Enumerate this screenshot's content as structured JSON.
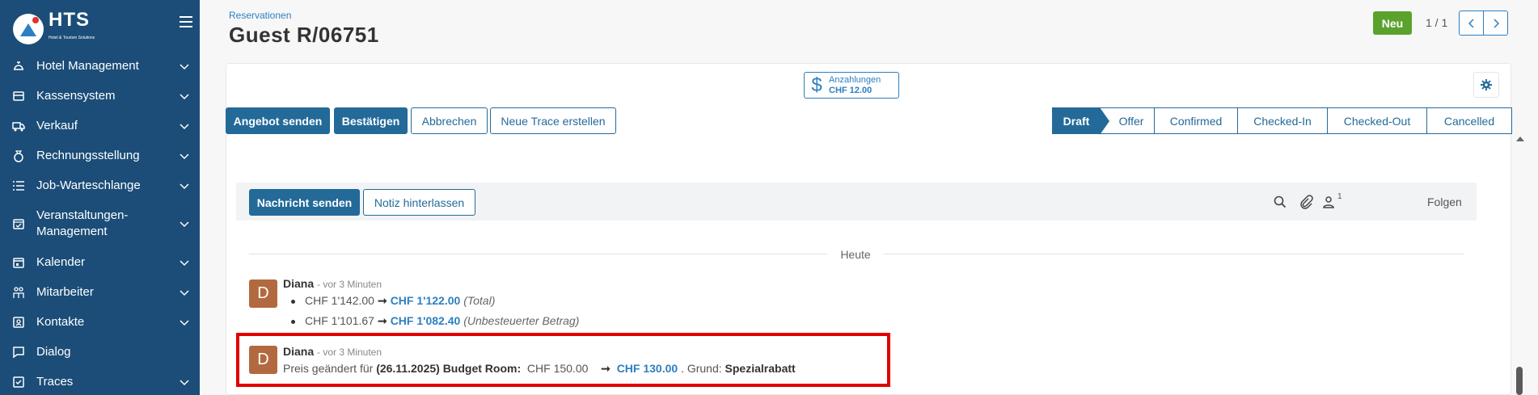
{
  "sidebar": {
    "brand": "HTS",
    "brand_sub": "Hotel & Tourism Solutions",
    "items": [
      {
        "label": "Hotel Management",
        "icon": "bell-icon"
      },
      {
        "label": "Kassensystem",
        "icon": "register-icon"
      },
      {
        "label": "Verkauf",
        "icon": "truck-icon"
      },
      {
        "label": "Rechnungsstellung",
        "icon": "money-bag-icon"
      },
      {
        "label": "Job-Warteschlange",
        "icon": "list-icon"
      },
      {
        "label": "Veranstaltungen-Management",
        "icon": "calendar-check-icon"
      },
      {
        "label": "Kalender",
        "icon": "calendar-icon"
      },
      {
        "label": "Mitarbeiter",
        "icon": "users-icon"
      },
      {
        "label": "Kontakte",
        "icon": "contact-icon"
      },
      {
        "label": "Dialog",
        "icon": "chat-icon"
      },
      {
        "label": "Traces",
        "icon": "checkbox-icon"
      }
    ]
  },
  "header": {
    "breadcrumb": "Reservationen",
    "title": "Guest R/06751",
    "new_label": "Neu",
    "pager": "1 / 1"
  },
  "deposit": {
    "label": "Anzahlungen",
    "amount": "CHF 12.00"
  },
  "actions": {
    "send_offer": "Angebot senden",
    "confirm": "Bestätigen",
    "cancel": "Abbrechen",
    "new_trace": "Neue Trace erstellen"
  },
  "stages": [
    "Draft",
    "Offer",
    "Confirmed",
    "Checked-In",
    "Checked-Out",
    "Cancelled"
  ],
  "chatter": {
    "send_message": "Nachricht senden",
    "log_note": "Notiz hinterlassen",
    "followers_count": "1",
    "follow": "Folgen",
    "today": "Heute"
  },
  "messages": [
    {
      "avatar": "D",
      "author": "Diana",
      "ago": "- vor 3 Minuten",
      "changes": [
        {
          "old": "CHF 1'142.00",
          "new": "CHF 1'122.00",
          "field": "(Total)"
        },
        {
          "old": "CHF 1'101.67",
          "new": "CHF 1'082.40",
          "field": "(Unbesteuerter Betrag)"
        }
      ]
    },
    {
      "avatar": "D",
      "author": "Diana",
      "ago": "- vor 3 Minuten",
      "prefix": "Preis geändert für",
      "subject": "(26.11.2025) Budget Room:",
      "old": "CHF 150.00",
      "new": "CHF 130.00",
      "reason_label": ". Grund:",
      "reason": "Spezialrabatt"
    }
  ],
  "colors": {
    "sidebar": "#1b4d78",
    "primary": "#236a99",
    "success": "#5ba22d",
    "avatar": "#b3693f",
    "highlight": "#e00000"
  }
}
